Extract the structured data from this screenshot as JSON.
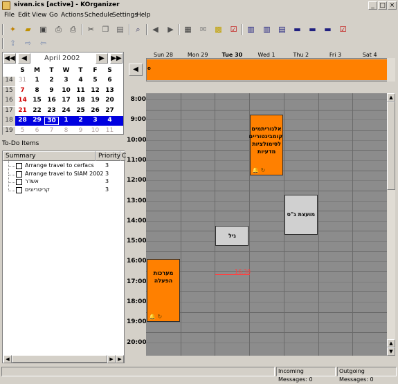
{
  "window": {
    "title": "sivan.ics [active] - KOrganizer"
  },
  "titlebar_buttons": [
    "_",
    "□",
    "×"
  ],
  "menu": [
    "File",
    "Edit",
    "View",
    "Go",
    "Actions",
    "Schedule",
    "Settings",
    "Help"
  ],
  "toolbar_icons": [
    "new-icon",
    "open-icon",
    "save-icon",
    "print-icon",
    "print-preview-icon",
    "cut-icon",
    "copy-icon",
    "paste-icon",
    "find-icon",
    "previous-icon",
    "next-icon",
    "today-icon",
    "mail-icon",
    "new-event-icon",
    "new-todo-icon",
    "day-view-icon",
    "workweek-view-icon",
    "week-view-icon",
    "nextx-view-icon",
    "month-view-icon",
    "list-view-icon",
    "todo-view-icon"
  ],
  "datenav": {
    "month_label": "April 2002",
    "weekday_headers": [
      "S",
      "M",
      "T",
      "W",
      "T",
      "F",
      "S"
    ],
    "weeks": [
      {
        "wk": "14",
        "days": [
          "31",
          "1",
          "2",
          "3",
          "4",
          "5",
          "6"
        ]
      },
      {
        "wk": "15",
        "days": [
          "7",
          "8",
          "9",
          "10",
          "11",
          "12",
          "13"
        ]
      },
      {
        "wk": "16",
        "days": [
          "14",
          "15",
          "16",
          "17",
          "18",
          "19",
          "20"
        ]
      },
      {
        "wk": "17",
        "days": [
          "21",
          "22",
          "23",
          "24",
          "25",
          "26",
          "27"
        ]
      },
      {
        "wk": "18",
        "days": [
          "28",
          "29",
          "30",
          "1",
          "2",
          "3",
          "4"
        ]
      },
      {
        "wk": "19",
        "days": [
          "5",
          "6",
          "7",
          "8",
          "9",
          "10",
          "11"
        ]
      }
    ]
  },
  "todo": {
    "title": "To-Do Items",
    "columns": [
      "Summary",
      "Priority",
      "C"
    ],
    "items": [
      {
        "summary": "Arrange travel to cerfacs",
        "priority": "3"
      },
      {
        "summary": "Arrange travel to SIAM 2002",
        "priority": "3"
      },
      {
        "summary": "אשדר",
        "priority": "3"
      },
      {
        "summary": "קריטריונים",
        "priority": "3"
      }
    ]
  },
  "calendar": {
    "days": [
      "Sun 28",
      "Mon 29",
      "Tue 30",
      "Wed 1",
      "Thu 2",
      "Fri 3",
      "Sat 4"
    ],
    "allday_event": "o",
    "hours": [
      "8:00",
      "9:00",
      "10:00",
      "11:00",
      "12:00",
      "13:00",
      "14:00",
      "15:00",
      "16:00",
      "17:00",
      "18:00",
      "19:00",
      "20:00"
    ],
    "current_time": "16:38",
    "events": [
      {
        "title": "אלגוריתמים קומבינטוריים לסימולציות מדעיות",
        "color": "orange",
        "icons": "🔔 ↻"
      },
      {
        "title": "מועצת ג\"ס",
        "color": "gray",
        "icons": ""
      },
      {
        "title": "גיל",
        "color": "gray",
        "icons": ""
      },
      {
        "title": "מערכות הפעלה",
        "color": "orange",
        "icons": "🔔 ↻"
      }
    ]
  },
  "status": {
    "incoming": "Incoming Messages: 0",
    "outgoing": "Outgoing Messages: 0"
  }
}
